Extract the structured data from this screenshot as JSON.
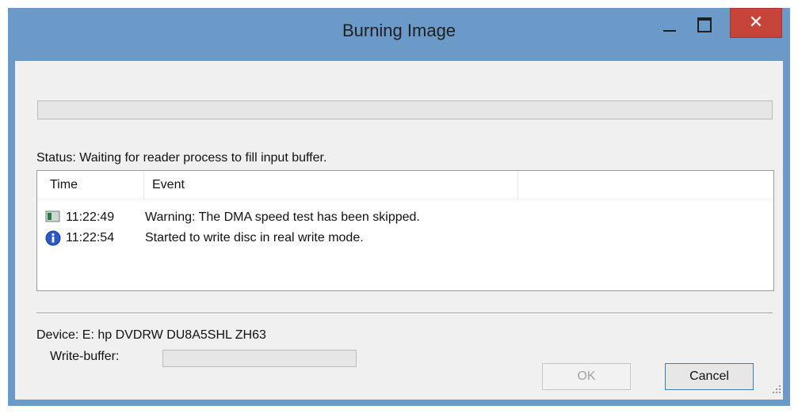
{
  "window": {
    "title": "Burning Image"
  },
  "titlebar_icons": {
    "minimize": "minimize-icon",
    "maximize": "maximize-icon",
    "close": "close-icon",
    "close_glyph": "✕"
  },
  "progress": {
    "value": 0
  },
  "status": {
    "text": "Status: Waiting for reader process to fill input buffer."
  },
  "log": {
    "columns": [
      "Time",
      "Event"
    ],
    "rows": [
      {
        "icon": "warning-flag-icon",
        "time": "11:22:49",
        "event": "Warning: The DMA speed test has been skipped."
      },
      {
        "icon": "info-icon",
        "time": "11:22:54",
        "event": "Started to write disc in real write mode."
      }
    ]
  },
  "device": {
    "text": "Device: E: hp DVDRW  DU8A5SHL ZH63"
  },
  "write_buffer": {
    "label": "Write-buffer:",
    "value": 0
  },
  "buttons": {
    "ok": "OK",
    "cancel": "Cancel"
  },
  "colors": {
    "titlebar": "#6b9ac8",
    "close": "#c7443a",
    "client": "#f0f0f0",
    "focus_border": "#3c7fb1"
  }
}
